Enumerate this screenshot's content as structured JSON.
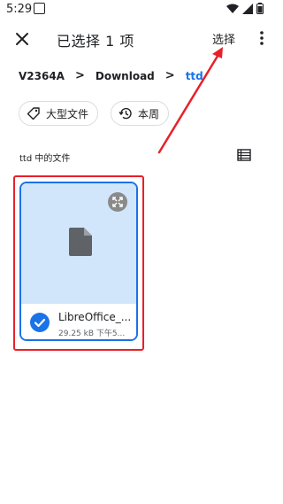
{
  "status_bar": {
    "time": "5:29"
  },
  "header": {
    "title": "已选择 1 项",
    "select_label": "选择"
  },
  "breadcrumb": {
    "items": [
      "V2364A",
      "Download",
      "ttd"
    ],
    "separator": ">"
  },
  "chips": [
    {
      "label": "大型文件",
      "icon": "tag-icon"
    },
    {
      "label": "本周",
      "icon": "history-icon"
    }
  ],
  "section": {
    "label": "ttd 中的文件"
  },
  "file": {
    "name": "LibreOffice_...",
    "meta": "29.25 kB 下午5..."
  },
  "colors": {
    "accent": "#1a73e8",
    "selection_bg": "#d2e6fb",
    "annotation_red": "#e8202a"
  }
}
